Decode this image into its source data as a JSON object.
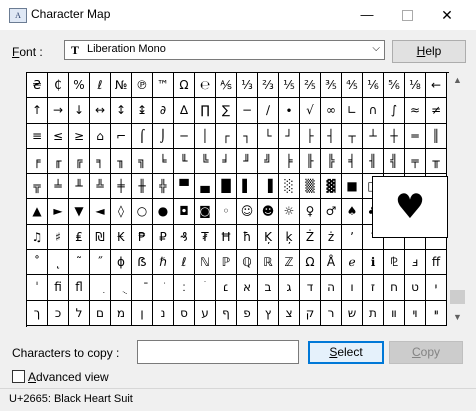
{
  "window": {
    "title": "Character Map",
    "minimize_symbol": "—",
    "close_symbol": "✕"
  },
  "font": {
    "label_prefix": "",
    "label_accel": "F",
    "label_rest": "ont :",
    "selected": "Liberation Mono",
    "icon_glyph": "T",
    "dropdown_arrow": "⌵"
  },
  "buttons": {
    "help_accel": "H",
    "help_rest": "elp",
    "select_accel": "S",
    "select_rest": "elect",
    "copy_accel": "C",
    "copy_rest": "opy"
  },
  "grid": {
    "cells": [
      "₴",
      "₵",
      "%",
      "ℓ",
      "№",
      "℗",
      "™",
      "Ω",
      "℮",
      "⅍",
      "⅓",
      "⅔",
      "⅕",
      "⅖",
      "⅗",
      "⅘",
      "⅙",
      "⅚",
      "⅛",
      "←",
      "↑",
      "→",
      "↓",
      "↔",
      "↕",
      "↨",
      "∂",
      "∆",
      "∏",
      "∑",
      "−",
      "∕",
      "∙",
      "√",
      "∞",
      "∟",
      "∩",
      "∫",
      "≈",
      "≠",
      "≡",
      "≤",
      "≥",
      "⌂",
      "⌐",
      "⌠",
      "⌡",
      "─",
      "│",
      "┌",
      "┐",
      "└",
      "┘",
      "├",
      "┤",
      "┬",
      "┴",
      "┼",
      "═",
      "║",
      "╒",
      "╓",
      "╔",
      "╕",
      "╖",
      "╗",
      "╘",
      "╙",
      "╚",
      "╛",
      "╜",
      "╝",
      "╞",
      "╟",
      "╠",
      "╡",
      "╢",
      "╣",
      "╤",
      "╥",
      "╦",
      "╧",
      "╨",
      "╩",
      "╪",
      "╫",
      "╬",
      "▀",
      "▄",
      "█",
      "▌",
      "▐",
      "░",
      "▒",
      "▓",
      "■",
      "□",
      "▪",
      "▫",
      "▬",
      "▲",
      "►",
      "▼",
      "◄",
      "◊",
      "○",
      "●",
      "◘",
      "◙",
      "◦",
      "☺",
      "☻",
      "☼",
      "♀",
      "♂",
      "♠",
      "♣",
      "♥",
      "♦",
      "♪",
      "♫",
      "♯",
      "₤",
      "₪",
      "₭",
      "₱",
      "₽",
      "₰",
      "₮",
      "Ħ",
      "ħ",
      "Ķ",
      "ķ",
      "Ż",
      "ż",
      "ʼ",
      "ˆ",
      "ˇ",
      "˘",
      "˙",
      "˚",
      "˛",
      "˜",
      "˝",
      "ϕ",
      "ẞ",
      "ℏ",
      "ℓ",
      "ℕ",
      "ℙ",
      "ℚ",
      "ℝ",
      "ℤ",
      "Ω",
      "Å",
      "ℯ",
      "ℹ",
      "⅊",
      "ⅎ",
      "ﬀ",
      "ˈ",
      "ﬁ",
      "ﬂ",
      "ִ",
      "ֻ",
      "ֿ",
      "ׂ",
      "׃",
      "ׄ",
      "׆",
      "א",
      "ב",
      "ג",
      "ד",
      "ה",
      "ו",
      "ז",
      "ח",
      "ט",
      "י",
      "ך",
      "כ",
      "ל",
      "ם",
      "מ",
      "ן",
      "נ",
      "ס",
      "ע",
      "ף",
      "פ",
      "ץ",
      "צ",
      "ק",
      "ר",
      "ש",
      "ת",
      "װ",
      "ױ",
      "ײ"
    ]
  },
  "popup": {
    "glyph": "♥"
  },
  "scrollbar": {
    "up_arrow": "▲",
    "down_arrow": "▼"
  },
  "copy": {
    "label": "Characters to copy :",
    "value": ""
  },
  "advanced": {
    "accel": "A",
    "rest": "dvanced view",
    "checked": false
  },
  "status": {
    "text": "U+2665: Black Heart Suit"
  }
}
